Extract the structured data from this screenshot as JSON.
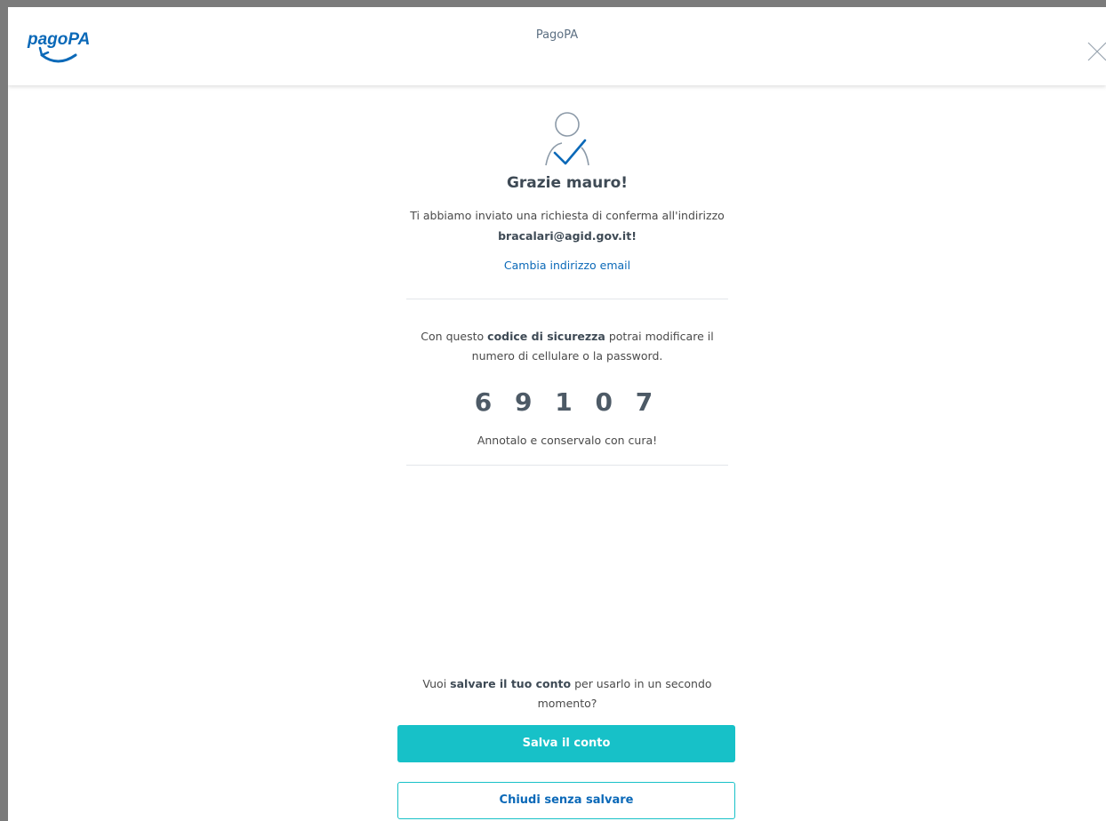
{
  "header": {
    "logo_text": "pagoPA",
    "title": "PagoPA",
    "close_icon": "close-icon"
  },
  "confirmation": {
    "icon": "user-check-icon",
    "greeting": "Grazie mauro!",
    "sent_text": "Ti abbiamo inviato una richiesta di conferma all'indirizzo",
    "email": "bracalari@agid.gov.it!",
    "change_email_link": "Cambia indirizzo email"
  },
  "security_code": {
    "text_before": "Con questo ",
    "text_bold": "codice di sicurezza",
    "text_after": " potrai modificare il numero di cellulare o la password.",
    "code": "6 9 1 0 7",
    "note": "Annotalo e conservalo con cura!"
  },
  "save_account": {
    "text_before": "Vuoi ",
    "text_bold": "salvare il tuo conto",
    "text_after": " per usarlo in un secondo momento?",
    "save_button": "Salva il conto",
    "close_button": "Chiudi senza salvare"
  },
  "colors": {
    "primary": "#17c1c8",
    "link": "#0b69b8",
    "text_dark": "#3e4a55",
    "background_border": "#7b7b7b"
  }
}
